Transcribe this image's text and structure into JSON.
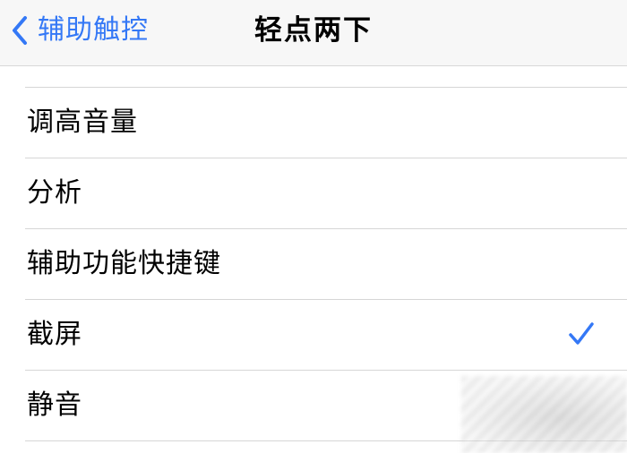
{
  "nav": {
    "back_label": "辅助触控",
    "title": "轻点两下",
    "back_icon": "chevron-left-icon",
    "accent_color": "#3478f6"
  },
  "list": {
    "items": [
      {
        "label": "调高音量",
        "selected": false
      },
      {
        "label": "分析",
        "selected": false
      },
      {
        "label": "辅助功能快捷键",
        "selected": false
      },
      {
        "label": "截屏",
        "selected": true
      },
      {
        "label": "静音",
        "selected": false
      }
    ],
    "check_icon": "checkmark-icon"
  }
}
